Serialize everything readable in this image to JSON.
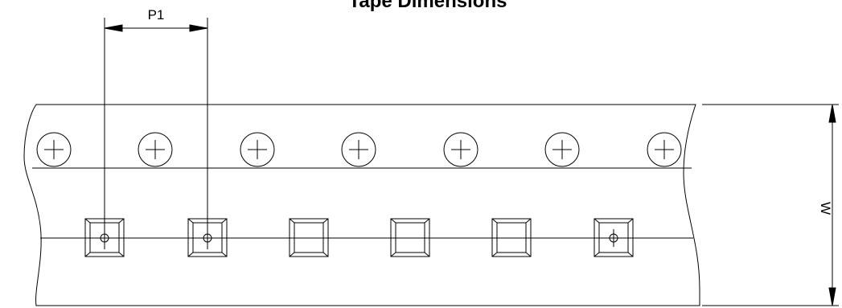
{
  "diagram": {
    "title": "Tape Dimensions",
    "pitch_label": "P1",
    "width_label": "W"
  }
}
